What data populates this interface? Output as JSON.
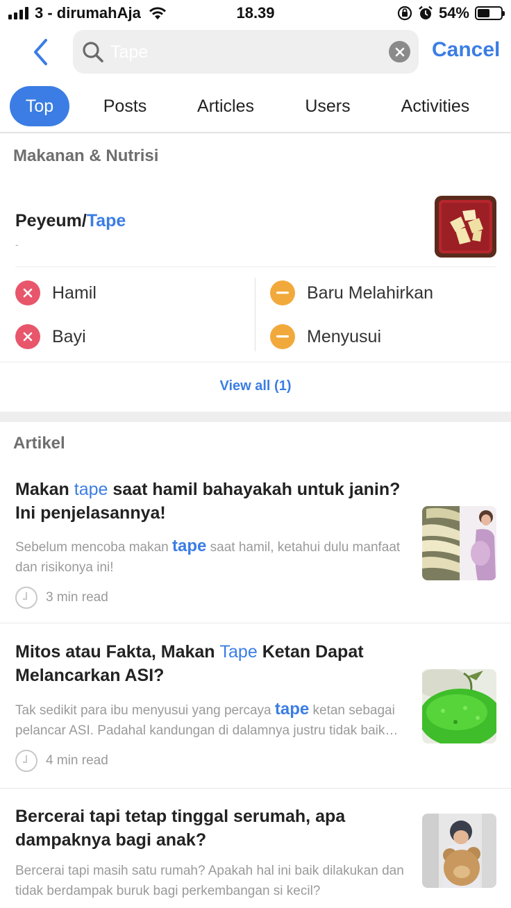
{
  "status_bar": {
    "carrier": "3 - dirumahAja",
    "time": "18.39",
    "battery_pct": "54%",
    "battery_level": 0.54
  },
  "search": {
    "query": "Tape",
    "placeholder": "Tape",
    "cancel_label": "Cancel"
  },
  "tabs": [
    {
      "label": "Top",
      "active": true
    },
    {
      "label": "Posts",
      "active": false
    },
    {
      "label": "Articles",
      "active": false
    },
    {
      "label": "Users",
      "active": false
    },
    {
      "label": "Activities",
      "active": false
    }
  ],
  "food_section": {
    "title": "Makanan & Nutrisi",
    "item": {
      "name_prefix": "Peyeum/",
      "name_highlight": "Tape",
      "subtitle": "-"
    },
    "statuses": [
      {
        "label": "Hamil",
        "level": "not-allowed"
      },
      {
        "label": "Bayi",
        "level": "not-allowed"
      },
      {
        "label": "Baru Melahirkan",
        "level": "caution"
      },
      {
        "label": "Menyusui",
        "level": "caution"
      }
    ],
    "view_all": "View all (1)"
  },
  "article_section": {
    "title": "Artikel",
    "articles": [
      {
        "title_pre": "Makan ",
        "title_hl": "tape",
        "title_post": " saat hamil bahayakah untuk janin? Ini penjelasannya!",
        "desc_pre": "Sebelum mencoba makan ",
        "desc_hl": "tape",
        "desc_post": " saat hamil, ketahui dulu manfaat dan risikonya ini!",
        "read_time": "3 min read"
      },
      {
        "title_pre": "Mitos atau Fakta, Makan ",
        "title_hl": "Tape",
        "title_post": " Ketan Dapat Melancarkan ASI?",
        "desc_pre": "Tak sedikit para ibu menyusui yang percaya ",
        "desc_hl": "tape",
        "desc_post": " ketan sebagai pelancar ASI. Padahal kandungan di dalamnya justru tidak baik untuk ASI.",
        "read_time": "4 min read"
      },
      {
        "title_pre": "Bercerai tapi tetap tinggal serumah, apa dampaknya bagi anak?",
        "title_hl": "",
        "title_post": "",
        "desc_pre": "Bercerai tapi masih satu rumah? Apakah hal ini baik dilakukan dan tidak berdampak buruk bagi perkembangan si kecil?",
        "desc_hl": "",
        "desc_post": "",
        "read_time": ""
      }
    ]
  },
  "colors": {
    "accent": "#3b7de4",
    "not_allowed": "#e8566c",
    "caution": "#f2a93b"
  }
}
